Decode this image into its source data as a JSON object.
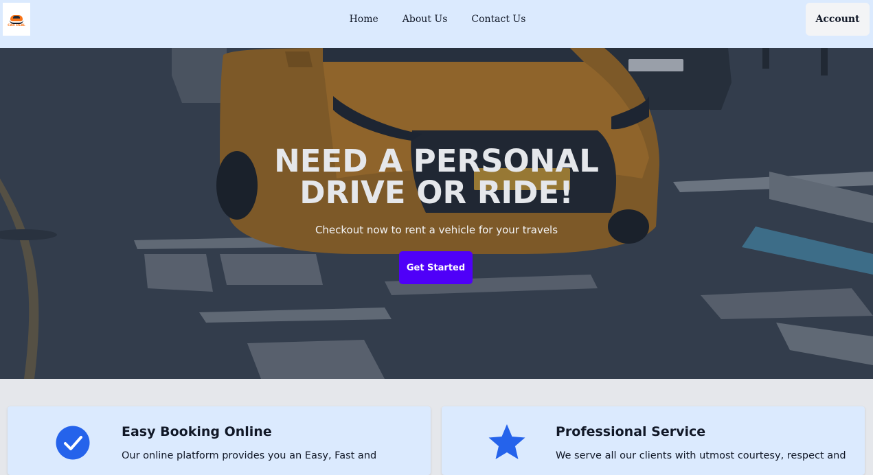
{
  "brand": {
    "logo_text": "CAR DEAL"
  },
  "nav": {
    "links": [
      {
        "label": "Home"
      },
      {
        "label": "About Us"
      },
      {
        "label": "Contact Us"
      }
    ],
    "account_label": "Account"
  },
  "hero": {
    "title_line1": "NEED A PERSONAL",
    "title_line2": "DRIVE OR RIDE!",
    "subtitle": "Checkout now to rent a vehicle for your travels",
    "cta_label": "Get Started"
  },
  "features": [
    {
      "icon": "check-circle-icon",
      "title": "Easy Booking Online",
      "text": "Our online platform provides you an Easy, Fast and"
    },
    {
      "icon": "star-icon",
      "title": "Professional Service",
      "text": "We serve all our clients with utmost courtesy, respect and"
    }
  ],
  "colors": {
    "nav_bg": "#dbeafe",
    "cta_bg": "#4f00f8",
    "icon_blue": "#2563eb",
    "page_bg": "#e5e7eb"
  }
}
